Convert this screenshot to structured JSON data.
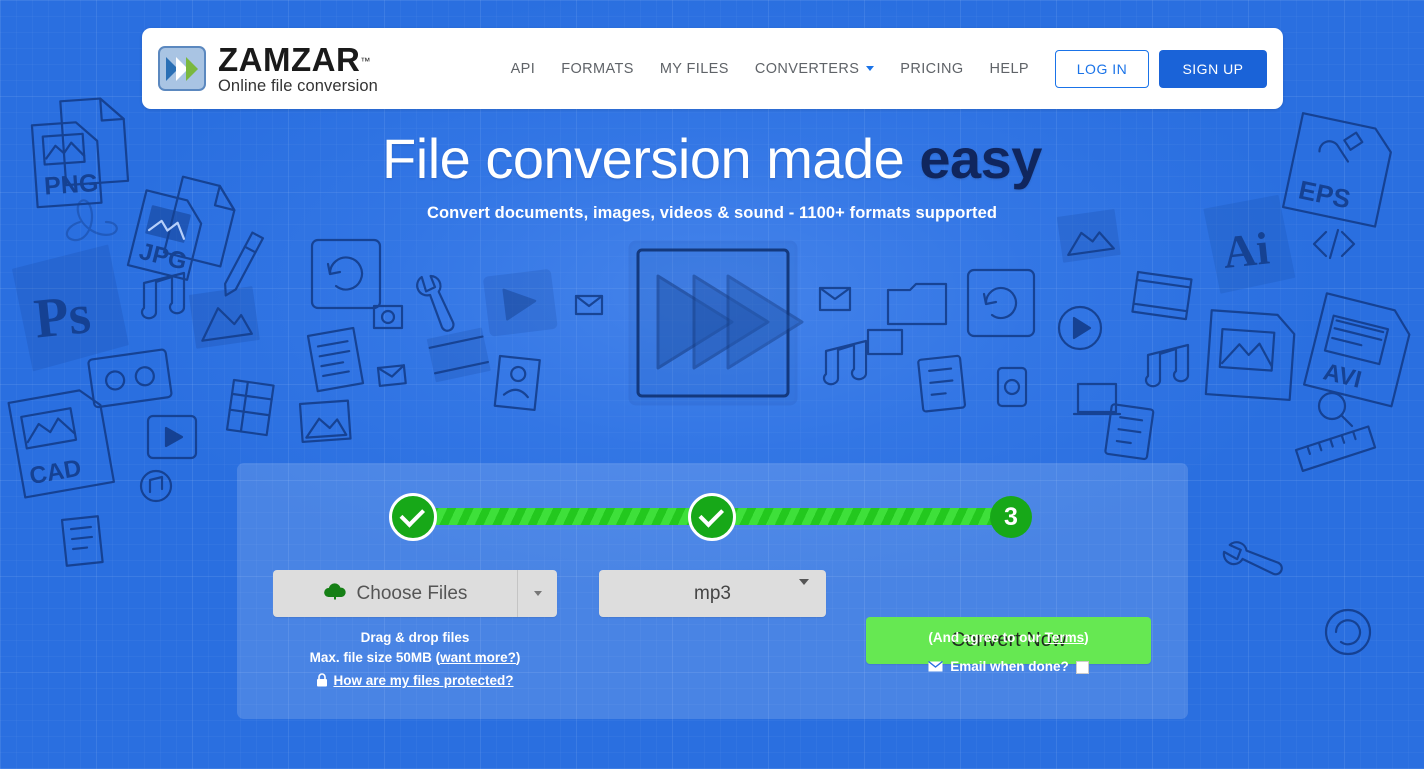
{
  "header": {
    "logo": {
      "icon": "double-chevron-icon",
      "word": "ZAMZAR",
      "tm": "™",
      "tagline": "Online file conversion"
    },
    "nav": [
      {
        "label": "API",
        "icon": null
      },
      {
        "label": "FORMATS",
        "icon": null
      },
      {
        "label": "MY FILES",
        "icon": null
      },
      {
        "label": "CONVERTERS",
        "icon": "chevron-down-icon"
      },
      {
        "label": "PRICING",
        "icon": null
      },
      {
        "label": "HELP",
        "icon": null
      }
    ],
    "login_label": "LOG IN",
    "signup_label": "SIGN UP"
  },
  "hero": {
    "title_plain": "File conversion made ",
    "title_emphasis": "easy",
    "subtitle": "Convert documents, images, videos & sound - 1100+ formats supported",
    "center_graphic": "fast-forward-play-sketch-icon"
  },
  "panel": {
    "steps": [
      {
        "label": "✓",
        "state": "complete"
      },
      {
        "label": "✓",
        "state": "complete"
      },
      {
        "label": "3",
        "state": "current"
      }
    ],
    "choose_files": {
      "label": "Choose Files",
      "icon": "cloud-upload-icon",
      "split_icon": "chevron-down-icon"
    },
    "format": {
      "value": "mp3",
      "icon": "chevron-down-icon"
    },
    "convert_button": "Convert Now",
    "help_left": {
      "drag_drop": "Drag & drop files",
      "max_size_prefix": "Max. file size 50MB (",
      "max_size_link": "want more?",
      "max_size_suffix": ")",
      "protected_icon": "lock-icon",
      "protected_link": "How are my files protected?"
    },
    "help_right": {
      "terms_prefix": "(And agree to our ",
      "terms_link": "Terms",
      "terms_suffix": ")",
      "email_icon": "envelope-icon",
      "email_label": "Email when done?",
      "email_checked": false
    }
  },
  "background": {
    "doodle_labels": [
      "PNG",
      "JPG",
      "Ps",
      "CAD",
      "EPS",
      "Ai",
      "AVI"
    ]
  },
  "colors": {
    "page_blue": "#2a6fe0",
    "brand_blue": "#1a63d8",
    "accent_green": "#17a818",
    "convert_green": "#66e852",
    "panel_overlay": "rgba(255,255,255,0.15)",
    "emphasis_navy": "#10265e"
  }
}
